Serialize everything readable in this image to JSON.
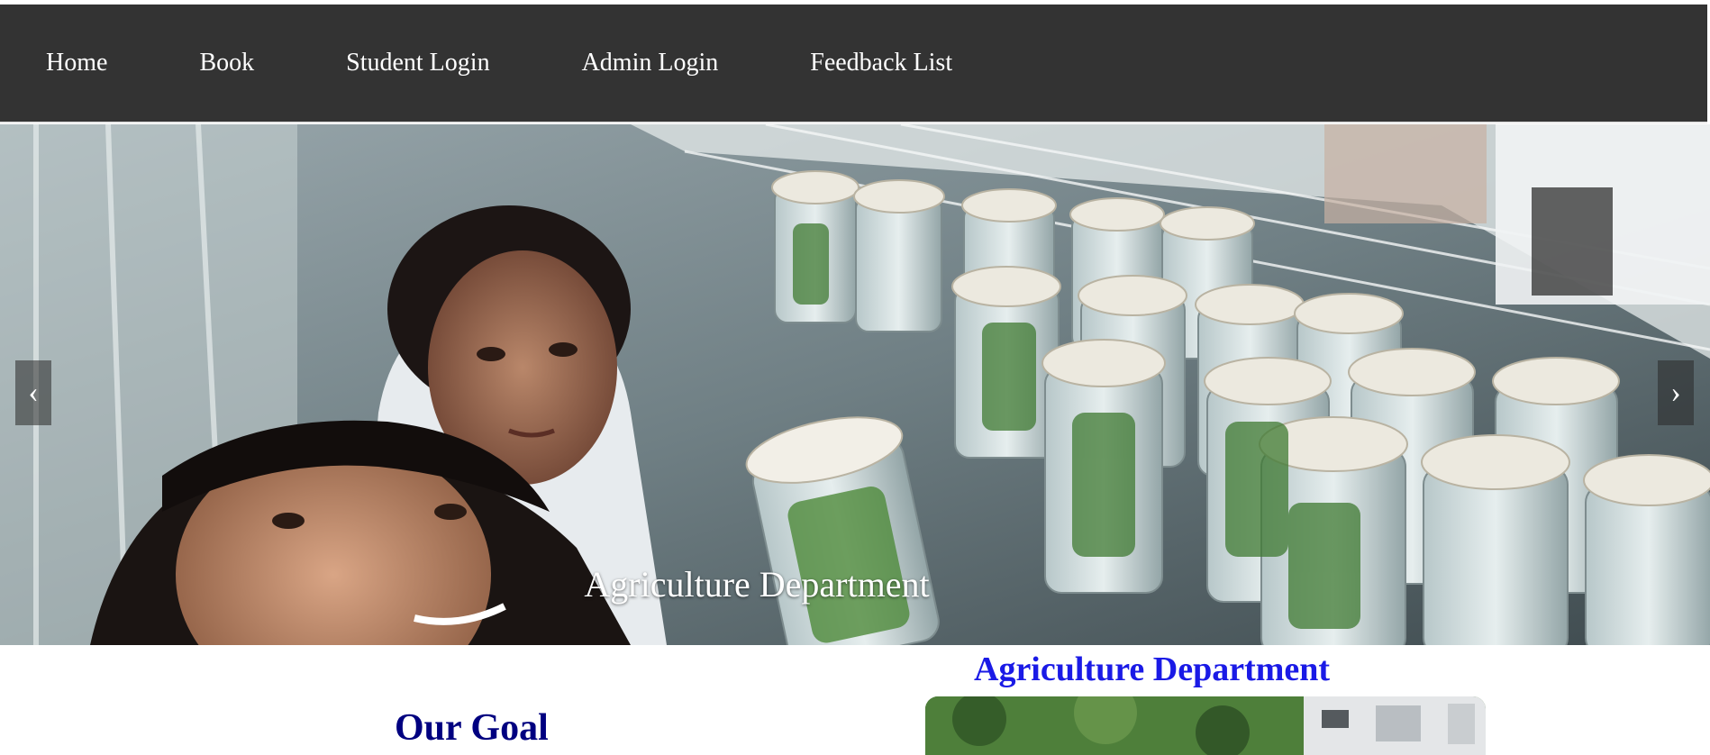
{
  "nav": {
    "items": [
      {
        "label": "Home"
      },
      {
        "label": "Book"
      },
      {
        "label": "Student Login"
      },
      {
        "label": "Admin Login"
      },
      {
        "label": "Feedback List"
      }
    ]
  },
  "carousel": {
    "caption": "Agriculture Department",
    "prev_glyph": "‹",
    "next_glyph": "›"
  },
  "content": {
    "goal_title": "Our Goal",
    "dept_title": "Agriculture Department"
  },
  "colors": {
    "navbar_bg": "#333333",
    "goal_title": "#000080",
    "dept_title": "#1a1ae6"
  }
}
